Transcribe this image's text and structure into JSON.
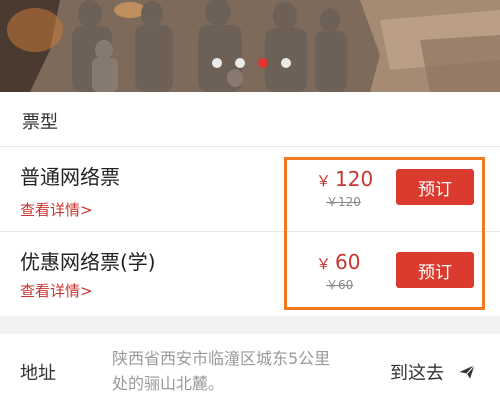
{
  "hero": {
    "slides": 4,
    "active_slide": 3
  },
  "tickets_header": {
    "title": "票型"
  },
  "tickets": [
    {
      "name": "普通网络票",
      "details_link": "查看详情>",
      "currency": "￥",
      "price": "120",
      "original_price": "￥120",
      "book_label": "预订"
    },
    {
      "name": "优惠网络票(学)",
      "details_link": "查看详情>",
      "currency": "￥",
      "price": "60",
      "original_price": "￥60",
      "book_label": "预订"
    }
  ],
  "address": {
    "label": "地址",
    "text": "陕西省西安市临潼区城东5公里处的骊山北麓。",
    "navigate_label": "到这去"
  },
  "colors": {
    "accent": "#da3b2e",
    "highlight": "#f0781e",
    "muted": "#9a9a9a"
  },
  "icons": {
    "navigate": "paper-plane-icon"
  }
}
